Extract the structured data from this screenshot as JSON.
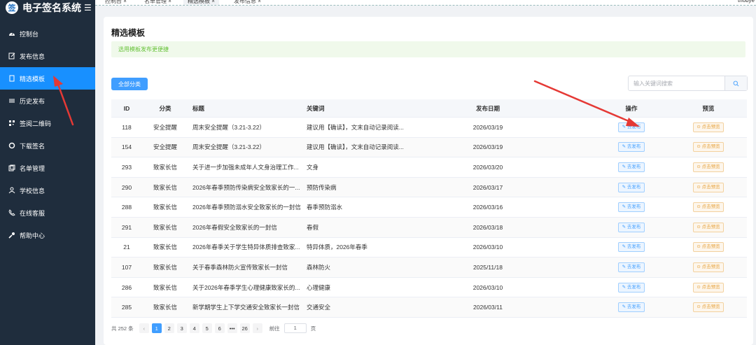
{
  "app": {
    "logo_char": "签",
    "title": "电子签名系统",
    "menu_toggle": "☰"
  },
  "tabs": [
    {
      "label": "控制台 ×"
    },
    {
      "label": "名单管理 ×"
    },
    {
      "label": "精选模板 ×"
    },
    {
      "label": "发布信息 ×"
    }
  ],
  "user": "tnobye",
  "sidebar": {
    "items": [
      {
        "label": "控制台",
        "icon": "dashboard-icon"
      },
      {
        "label": "发布信息",
        "icon": "edit-icon"
      },
      {
        "label": "精选模板",
        "icon": "template-icon",
        "active": true
      },
      {
        "label": "历史发布",
        "icon": "history-icon"
      },
      {
        "label": "签阅二维码",
        "icon": "qrcode-icon"
      },
      {
        "label": "下载签名",
        "icon": "download-icon"
      },
      {
        "label": "名单管理",
        "icon": "list-icon"
      },
      {
        "label": "学校信息",
        "icon": "user-icon"
      },
      {
        "label": "在线客服",
        "icon": "phone-icon"
      },
      {
        "label": "帮助中心",
        "icon": "wrench-icon"
      }
    ]
  },
  "main": {
    "page_title": "精选模板",
    "notice": "选用模板发布更便捷",
    "category_button": "全部分类",
    "search_placeholder": "输入关键词搜索"
  },
  "table": {
    "headers": {
      "id": "ID",
      "category": "分类",
      "title": "标题",
      "keywords": "关键词",
      "date": "发布日期",
      "op": "操作",
      "preview": "预览"
    },
    "publish_label": "✎ 去发布",
    "preview_label": "⊙ 点击预览",
    "rows": [
      {
        "id": "118",
        "category": "安全提醒",
        "title": "周末安全提醒（3.21-3.22）",
        "keywords": "建议用【确读】，文末自动记录阅读...",
        "date": "2026/03/19"
      },
      {
        "id": "154",
        "category": "安全提醒",
        "title": "周末安全提醒（3.21-3.22）",
        "keywords": "建议用【确读】，文末自动记录阅读...",
        "date": "2026/03/19"
      },
      {
        "id": "293",
        "category": "致家长信",
        "title": "关于进一步加强未成年人文身治理工作...",
        "keywords": "文身",
        "date": "2026/03/20"
      },
      {
        "id": "290",
        "category": "致家长信",
        "title": "2026年春季预防传染病安全致家长的一...",
        "keywords": "预防传染病",
        "date": "2026/03/17"
      },
      {
        "id": "288",
        "category": "致家长信",
        "title": "2026年春季预防溺水安全致家长的一封信",
        "keywords": "春季预防溺水",
        "date": "2026/03/16"
      },
      {
        "id": "291",
        "category": "致家长信",
        "title": "2026年春假安全致家长的一封信",
        "keywords": "春假",
        "date": "2026/03/18"
      },
      {
        "id": "21",
        "category": "致家长信",
        "title": "2026年春季关于学生特异体质排查致家...",
        "keywords": "特异体质，2026年春季",
        "date": "2026/03/10"
      },
      {
        "id": "107",
        "category": "致家长信",
        "title": "关于春季森林防火宣传致家长一封信",
        "keywords": "森林防火",
        "date": "2025/11/18"
      },
      {
        "id": "286",
        "category": "致家长信",
        "title": "关于2026年春季学生心理健康致家长的...",
        "keywords": "心理健康",
        "date": "2026/03/10"
      },
      {
        "id": "285",
        "category": "致家长信",
        "title": "新学期学生上下学交通安全致家长一封信",
        "keywords": "交通安全",
        "date": "2026/03/11"
      }
    ]
  },
  "pagination": {
    "total": "共 252 条",
    "prev": "‹",
    "pages": [
      "1",
      "2",
      "3",
      "4",
      "5",
      "6",
      "•••",
      "26"
    ],
    "next": "›",
    "goto_label": "前往",
    "goto_value": "1",
    "page_unit": "页"
  },
  "colors": {
    "sidebar_bg": "#1f2d3d",
    "accent": "#1890ff",
    "annotation": "#e53935"
  }
}
